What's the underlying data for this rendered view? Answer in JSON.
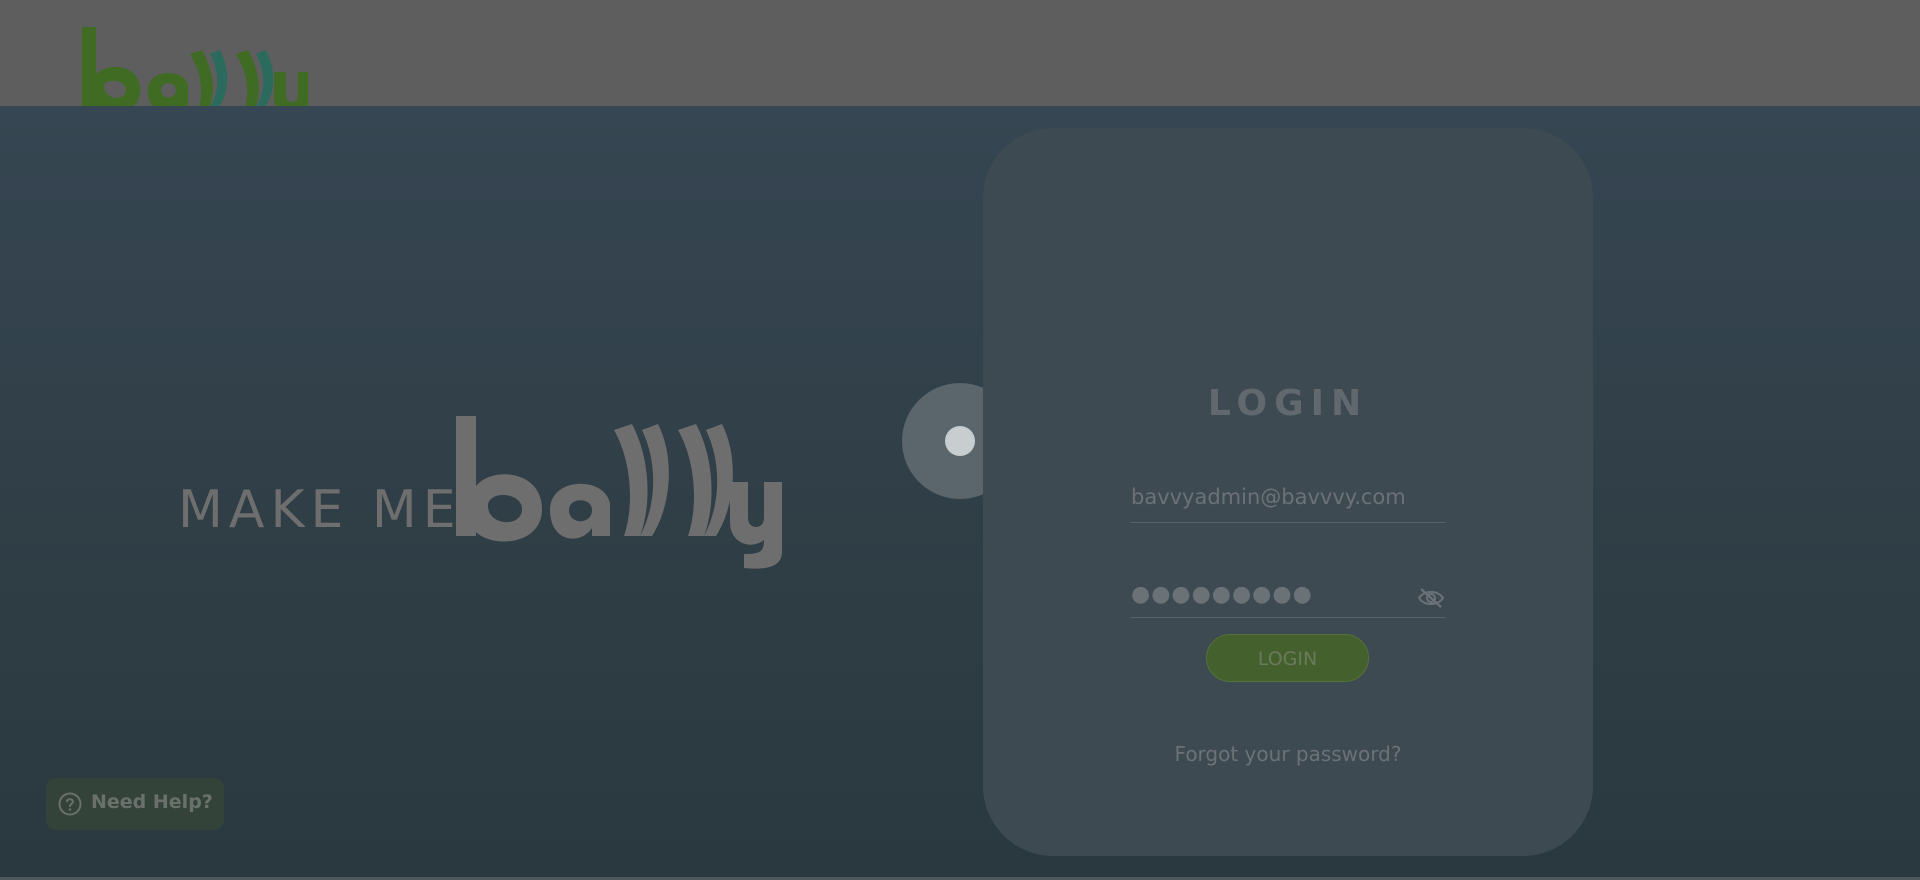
{
  "header": {
    "logo_text": "bavvy"
  },
  "hero": {
    "tagline": "MAKE ME",
    "logo_text": "bavvy"
  },
  "login_card": {
    "title": "LOGIN",
    "email_value": "bavvyadmin@bavvvy.com",
    "password_mask": "●●●●●●●●●",
    "password_toggle_icon": "eye-off-icon",
    "login_button_label": "LOGIN",
    "forgot_password_link": "Forgot your password?"
  },
  "help": {
    "icon": "question-circle-icon",
    "label": "Need Help?"
  },
  "colors": {
    "header_bg": "#5e5e5e",
    "page_bg": "#2f3e46",
    "card_bg": "#3e4a52",
    "brand_green": "#44602d",
    "logo_green": "#3f6b22",
    "logo_teal": "#2a6b5e"
  }
}
